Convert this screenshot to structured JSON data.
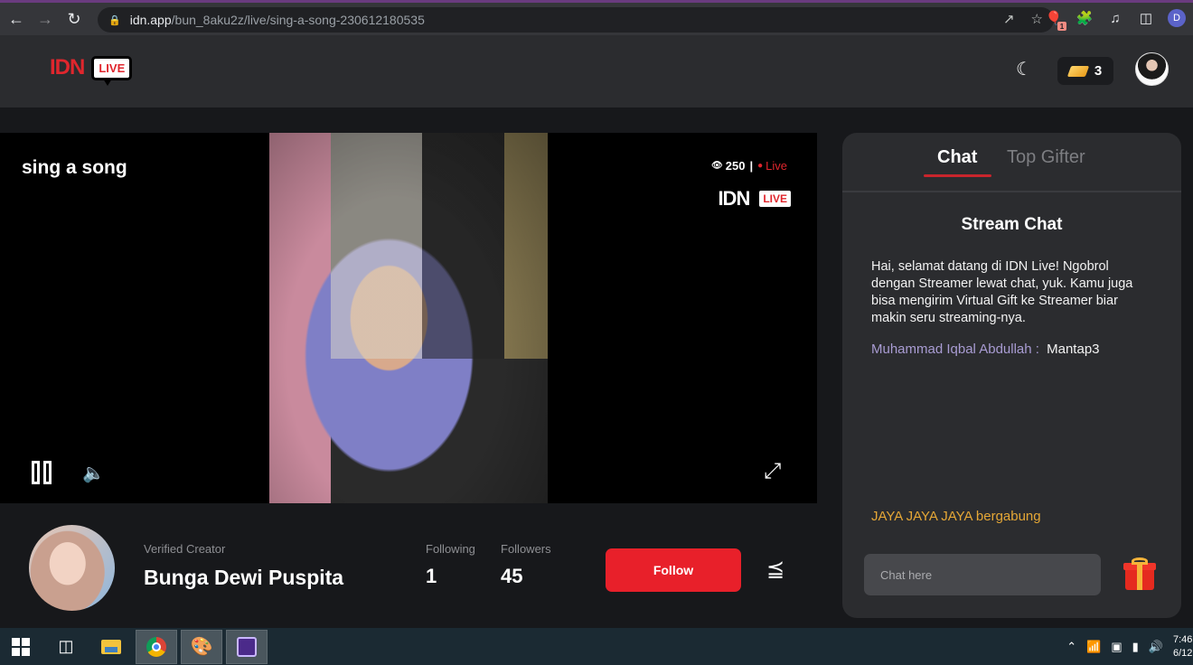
{
  "browser": {
    "url_host": "idn.app",
    "url_path": "/bun_8aku2z/live/sing-a-song-230612180535",
    "extension_badge": "1",
    "profile_initial": "D"
  },
  "header": {
    "logo_text": "IDN",
    "logo_badge": "LIVE",
    "coin_count": "3"
  },
  "player": {
    "title": "sing a song",
    "viewers": "250",
    "separator": "|",
    "live_label": "Live",
    "watermark_text": "IDN",
    "watermark_badge": "LIVE"
  },
  "creator": {
    "verified_label": "Verified Creator",
    "name": "Bunga Dewi Puspita",
    "following_label": "Following",
    "following_count": "1",
    "followers_label": "Followers",
    "followers_count": "45",
    "follow_button": "Follow"
  },
  "chat": {
    "tabs": [
      {
        "label": "Chat",
        "active": true
      },
      {
        "label": "Top Gifter",
        "active": false
      }
    ],
    "heading": "Stream Chat",
    "welcome": "Hai, selamat datang di IDN Live! Ngobrol dengan Streamer lewat chat, yuk. Kamu juga bisa mengirim Virtual Gift ke Streamer biar makin seru streaming-nya.",
    "messages": [
      {
        "user": "Muhammad Iqbal Abdullah :",
        "text": "Mantap3"
      }
    ],
    "join_notice": "JAYA JAYA JAYA bergabung",
    "input_placeholder": "Chat here"
  },
  "taskbar": {
    "time": "7:46",
    "date": "6/12"
  },
  "colors": {
    "accent_red": "#e8202a",
    "join_notice": "#e5a736",
    "chat_username": "#a99cd3"
  }
}
